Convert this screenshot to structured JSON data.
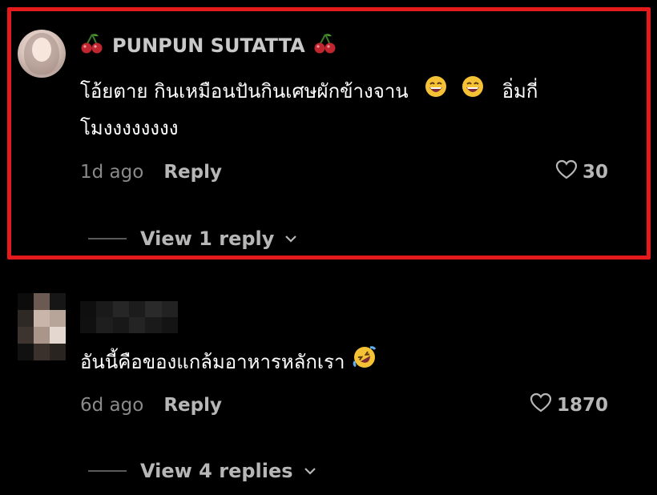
{
  "colors": {
    "background": "#000000",
    "highlight_border": "#e41a1c",
    "username": "#c9c9c9",
    "text": "#ffffff",
    "muted": "#8a8a8a",
    "action": "#b7b7b7"
  },
  "comments": [
    {
      "username": "PUNPUN SUTATTA",
      "username_decoration_icon": "cherry-icon",
      "text_line1": "โอ้ยตาย กินเหมือนปันกินเศษผักข้างจาน",
      "text_line1_emoji": "grinning-face-with-smiling-eyes-emoji",
      "text_line1_tail": "อิ่มกี่",
      "text_line2": "โมงงงงงงงง",
      "time": "1d ago",
      "reply_label": "Reply",
      "likes": "30",
      "view_replies": "View 1 reply",
      "highlighted": true,
      "avatar_icon": "profile-photo"
    },
    {
      "username": "",
      "username_blurred": true,
      "text_line1": "อันนี้คือของแกล้มอาหารหลักเรา",
      "text_line1_emoji": "rolling-on-the-floor-laughing-emoji",
      "time": "6d ago",
      "reply_label": "Reply",
      "likes": "1870",
      "view_replies": "View 4 replies",
      "highlighted": false,
      "avatar_icon": "pixelated-avatar"
    }
  ]
}
